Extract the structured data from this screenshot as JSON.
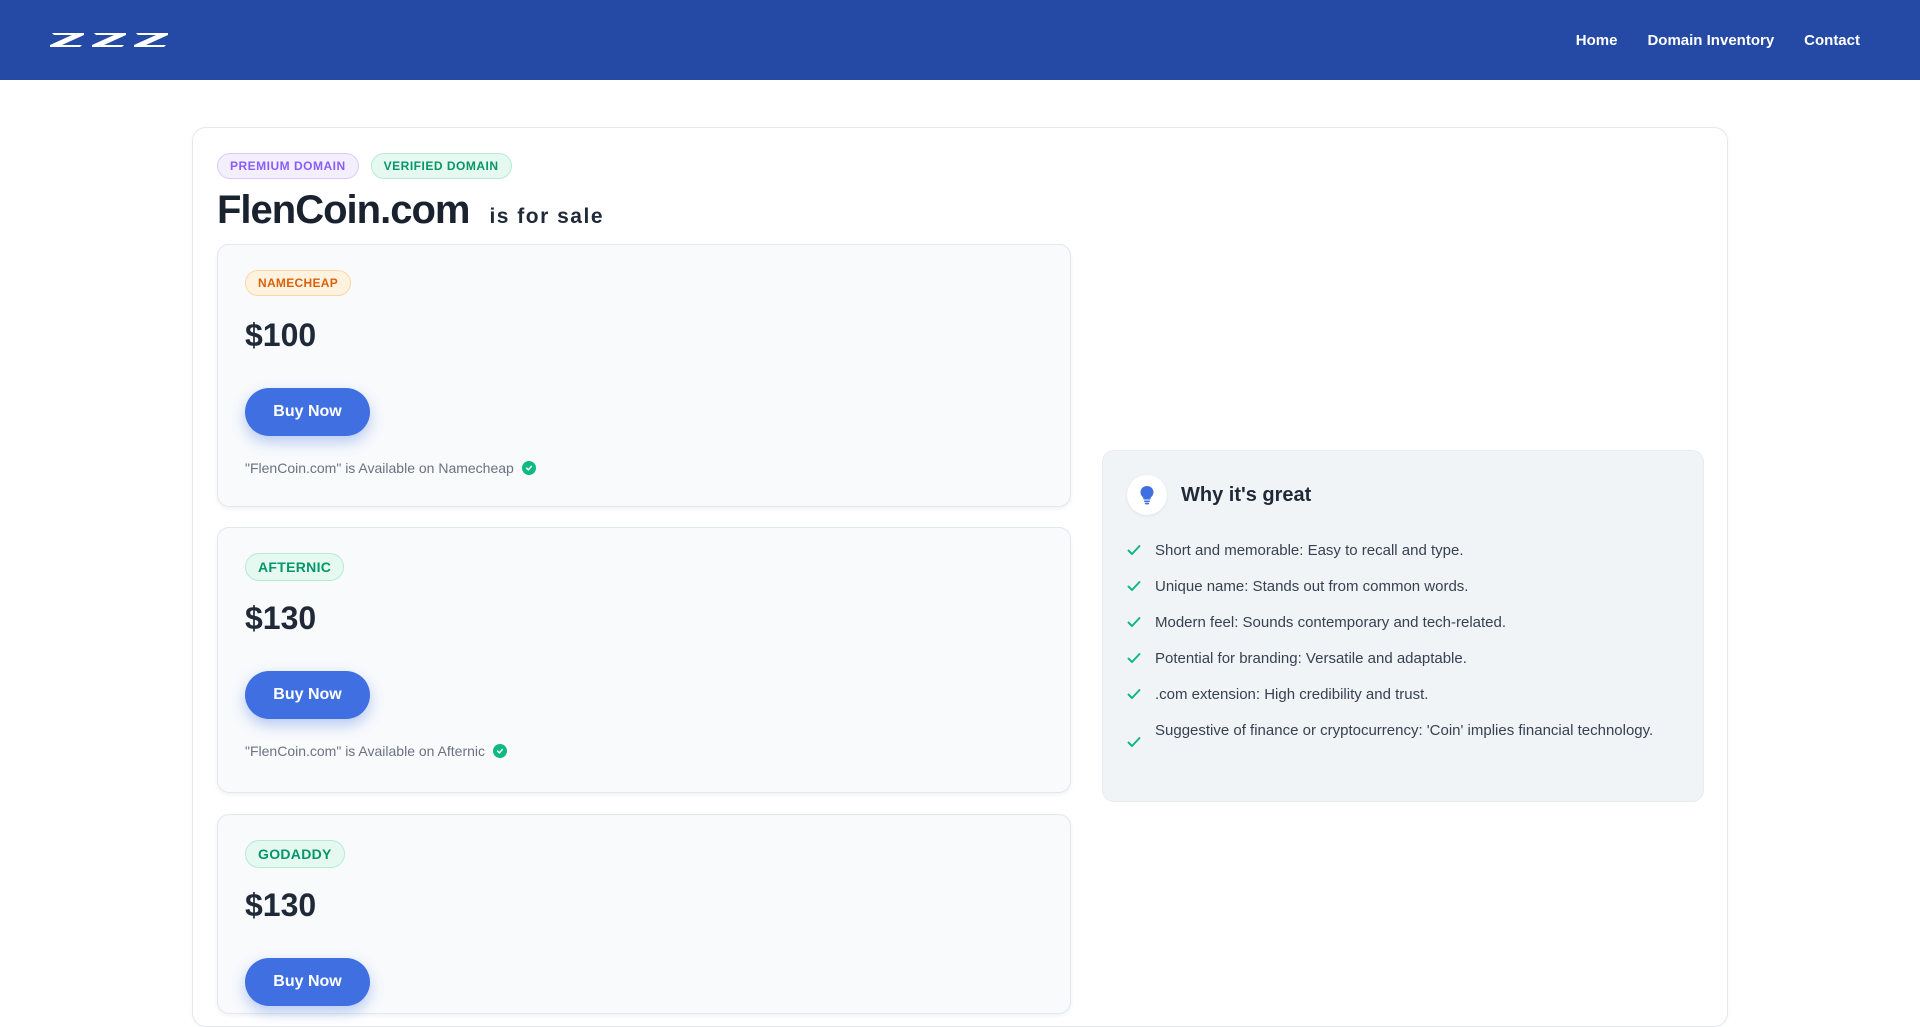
{
  "header": {
    "logo_text": "ZZZ",
    "nav": [
      "Home",
      "Domain Inventory",
      "Contact"
    ]
  },
  "domain": {
    "badges": [
      "PREMIUM DOMAIN",
      "VERIFIED DOMAIN"
    ],
    "name": "FlenCoin.com",
    "for_sale": "is for sale"
  },
  "offers": [
    {
      "marketplace": "NAMECHEAP",
      "price": "$100",
      "button": "Buy Now",
      "availability": "\"FlenCoin.com\" is Available on Namecheap"
    },
    {
      "marketplace": "AFTERNIC",
      "price": "$130",
      "button": "Buy Now",
      "availability": "\"FlenCoin.com\" is Available on Afternic"
    },
    {
      "marketplace": "GODADDY",
      "price": "$130",
      "button": "Buy Now",
      "availability": ""
    }
  ],
  "why": {
    "title": "Why it's great",
    "icon": "lightbulb-icon",
    "items": [
      "Short and memorable: Easy to recall and type.",
      "Unique name: Stands out from common words.",
      "Modern feel: Sounds contemporary and tech-related.",
      "Potential for branding: Versatile and adaptable.",
      ".com extension: High credibility and trust.",
      "Suggestive of finance or cryptocurrency: 'Coin' implies financial technology."
    ]
  },
  "colors": {
    "header_bg": "#254aa5",
    "button": "#3f6fe0",
    "success": "#10b981"
  }
}
